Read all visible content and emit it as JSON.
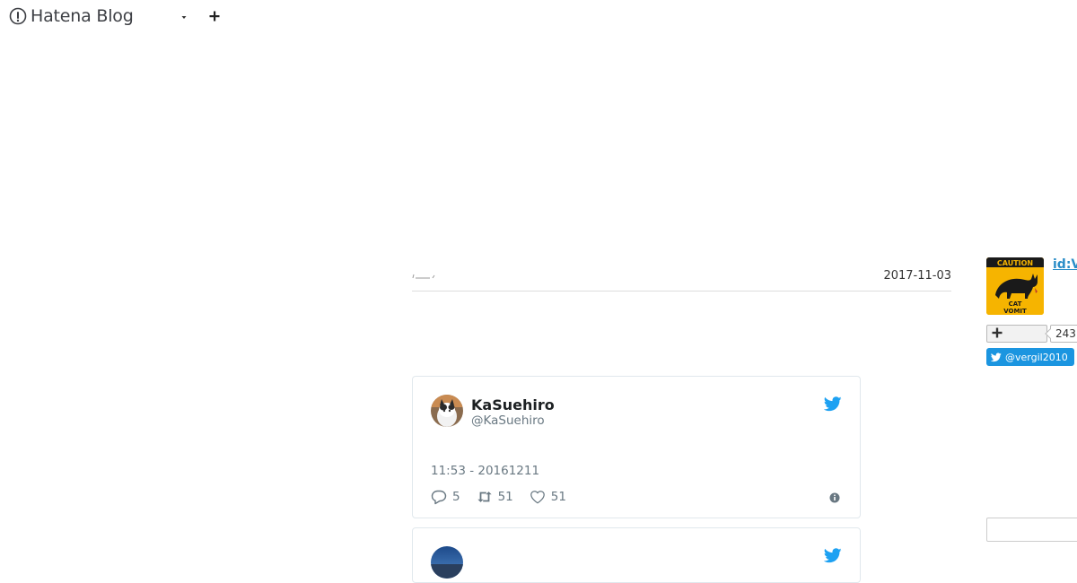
{
  "header": {
    "logo_text": "Hatena Blog"
  },
  "entry": {
    "date": "2017-11-03"
  },
  "tweets": [
    {
      "name": "KaSuehiro",
      "handle": "@KaSuehiro",
      "time": "11:53 - 20161211",
      "replies": "5",
      "retweets": "51",
      "likes": "51"
    },
    {
      "name": "",
      "handle": ""
    }
  ],
  "sidebar": {
    "user_id": "id:V",
    "avatar_caution_text": "CAUTION",
    "avatar_caption_line1": "CAT",
    "avatar_caption_line2": "VOMIT",
    "subscriber_count": "243",
    "twitter_follow_label": "@vergil2010"
  },
  "colors": {
    "twitter_blue": "#1da1f2",
    "follow_button": "#1b95e0",
    "sidebar_link": "#2a8dc7",
    "avatar_yellow": "#f6b400"
  }
}
